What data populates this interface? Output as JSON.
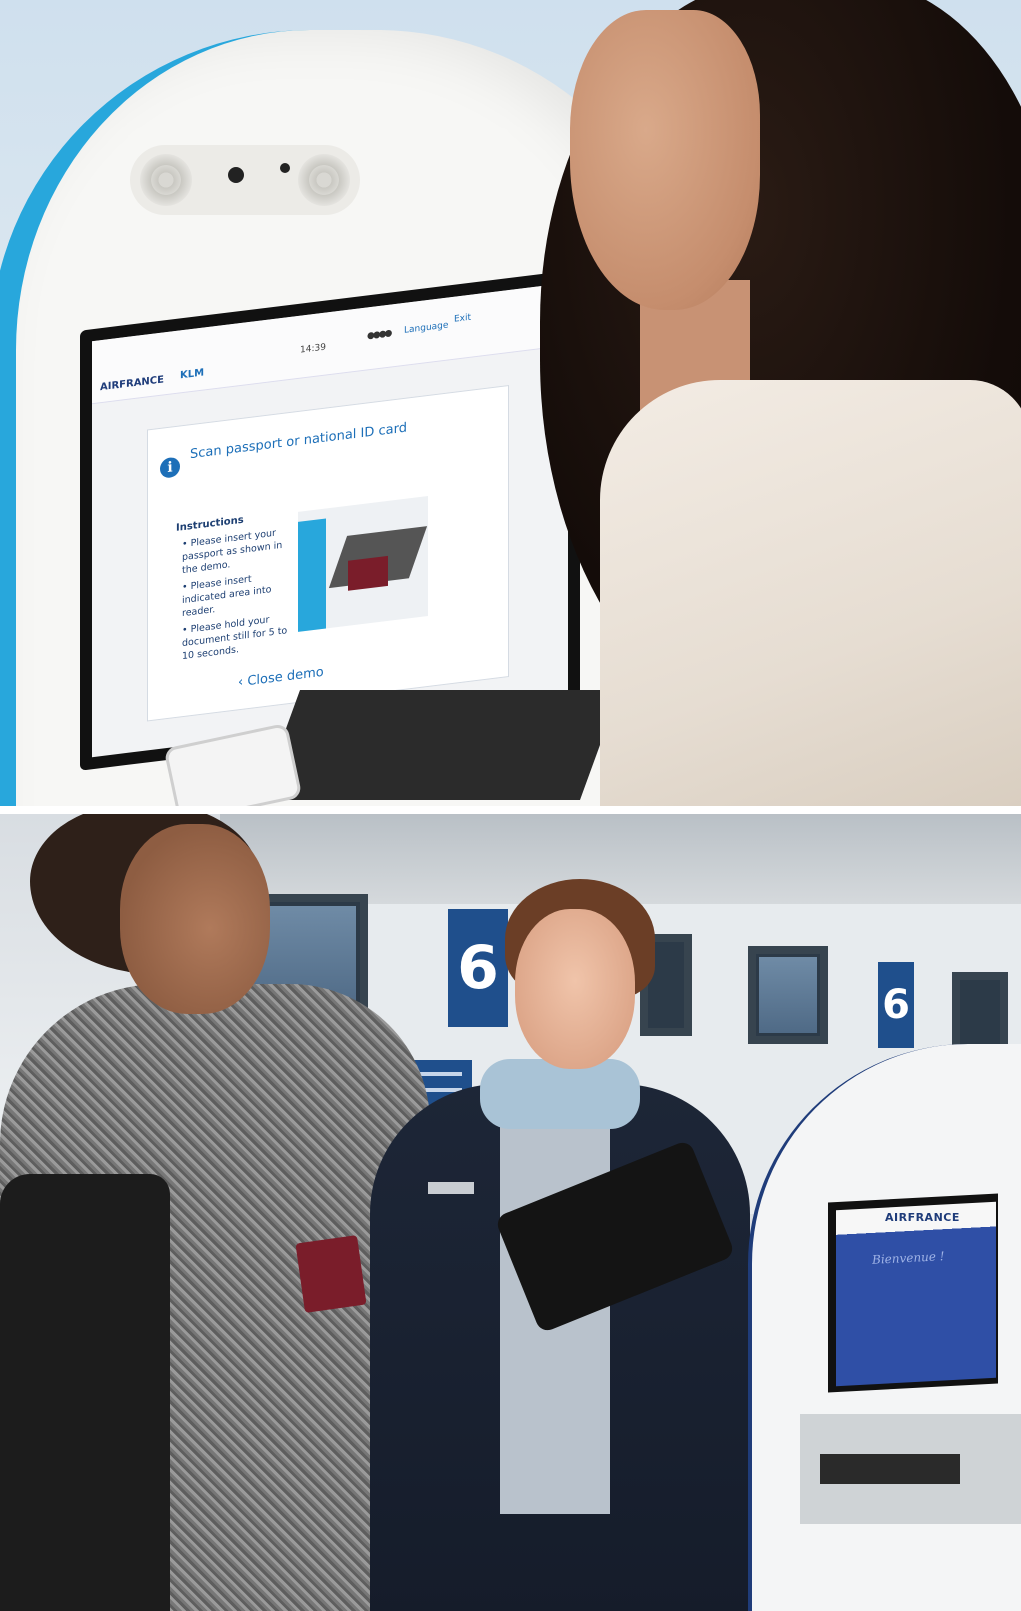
{
  "photo_top": {
    "kiosk_screen": {
      "logo_airfrance": "AIRFRANCE",
      "logo_klm": "KLM",
      "time": "14:39",
      "language": "Language",
      "exit": "Exit",
      "heading": "Scan passport or national ID card",
      "instructions_title": "Instructions",
      "instructions": [
        "Please insert your passport as shown in the demo.",
        "Please insert indicated area into reader.",
        "Please hold your document still for 5 to 10 seconds."
      ],
      "close_demo": "Close demo"
    }
  },
  "photo_bottom": {
    "counter_number": "6",
    "kiosk_brand": "AIRFRANCE",
    "kiosk_greeting": "Bienvenue !"
  },
  "colors": {
    "kiosk_accent_blue": "#28a7dc",
    "airfrance_navy": "#1f3c7a",
    "screen_text_blue": "#1d6fb8"
  }
}
